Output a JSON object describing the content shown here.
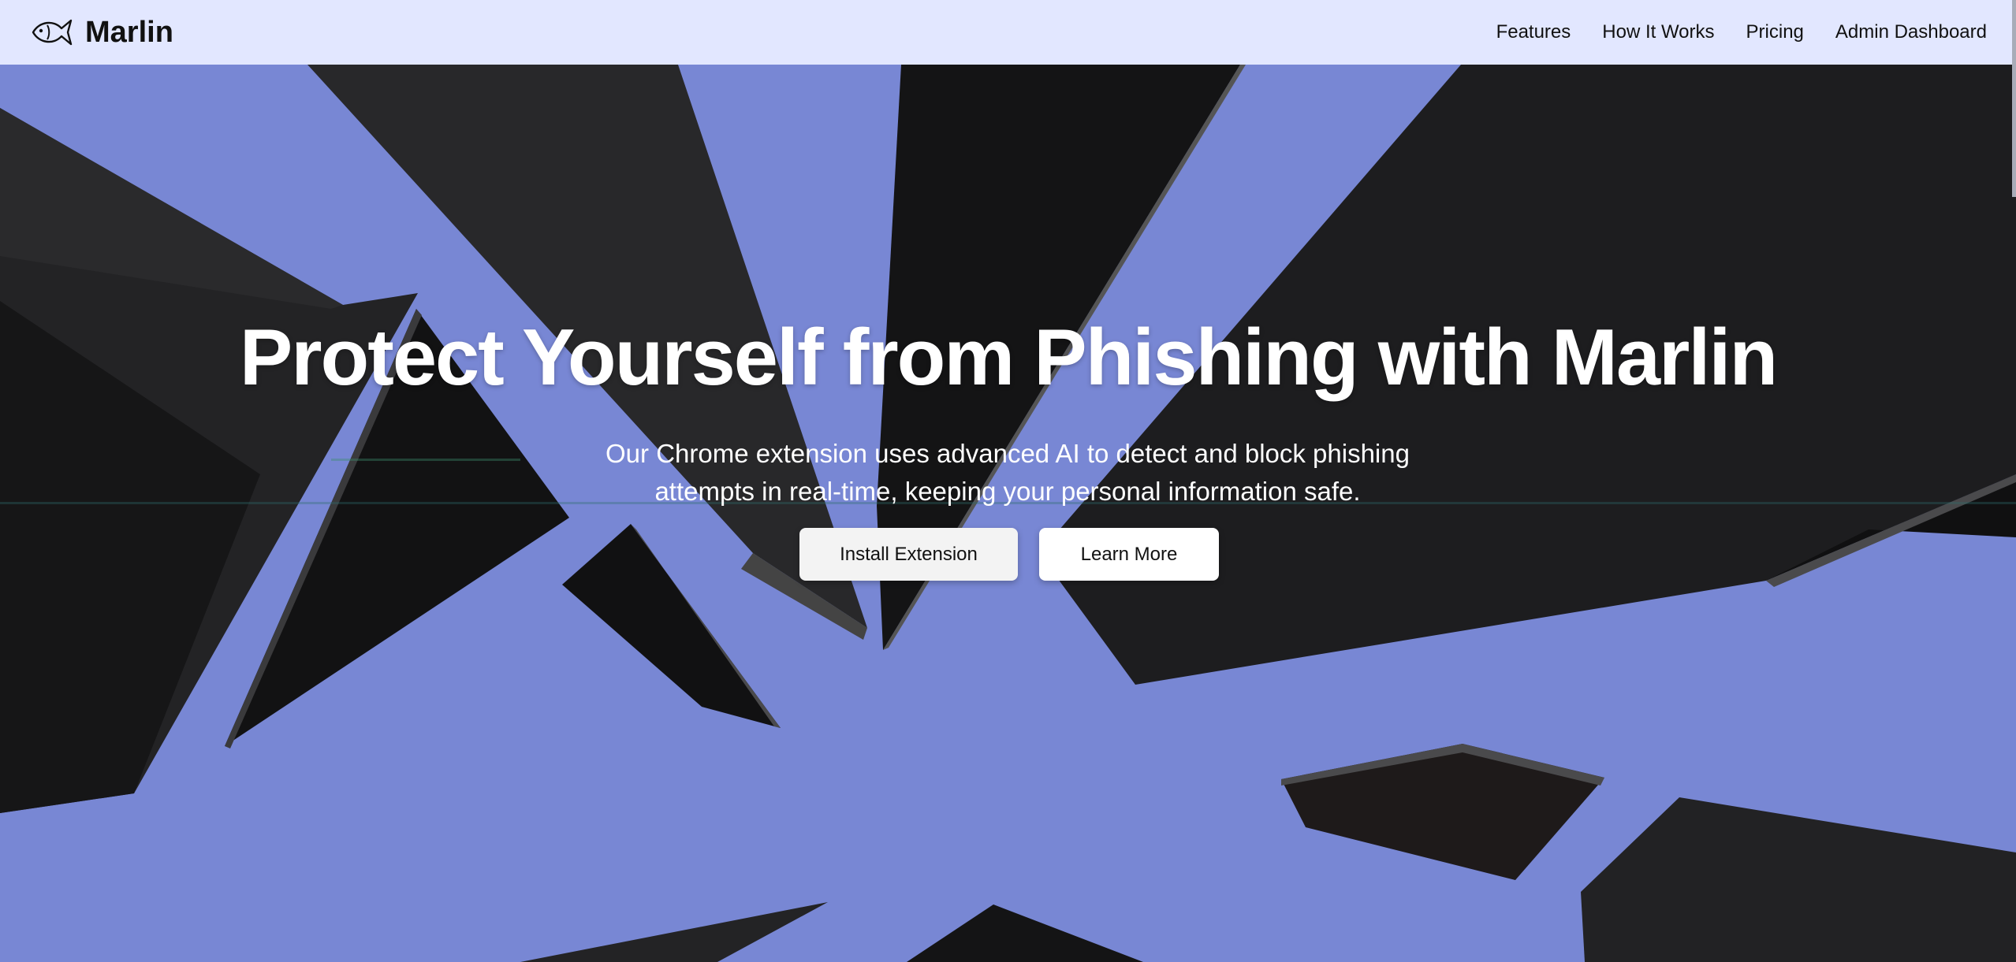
{
  "brand": {
    "name": "Marlin",
    "logo_icon": "fish-icon"
  },
  "nav": {
    "links": [
      {
        "label": "Features"
      },
      {
        "label": "How It Works"
      },
      {
        "label": "Pricing"
      },
      {
        "label": "Admin Dashboard"
      }
    ]
  },
  "hero": {
    "title": "Protect Yourself from Phishing with Marlin",
    "subtitle": "Our Chrome extension uses advanced AI to detect and block phishing attempts in real-time, keeping your personal information safe.",
    "primary_button": "Install Extension",
    "secondary_button": "Learn More"
  },
  "colors": {
    "nav_background": "#e2e7ff",
    "hero_background": "#7887d4",
    "shard_dark": "#1b1b1d",
    "text_light": "#ffffff"
  }
}
